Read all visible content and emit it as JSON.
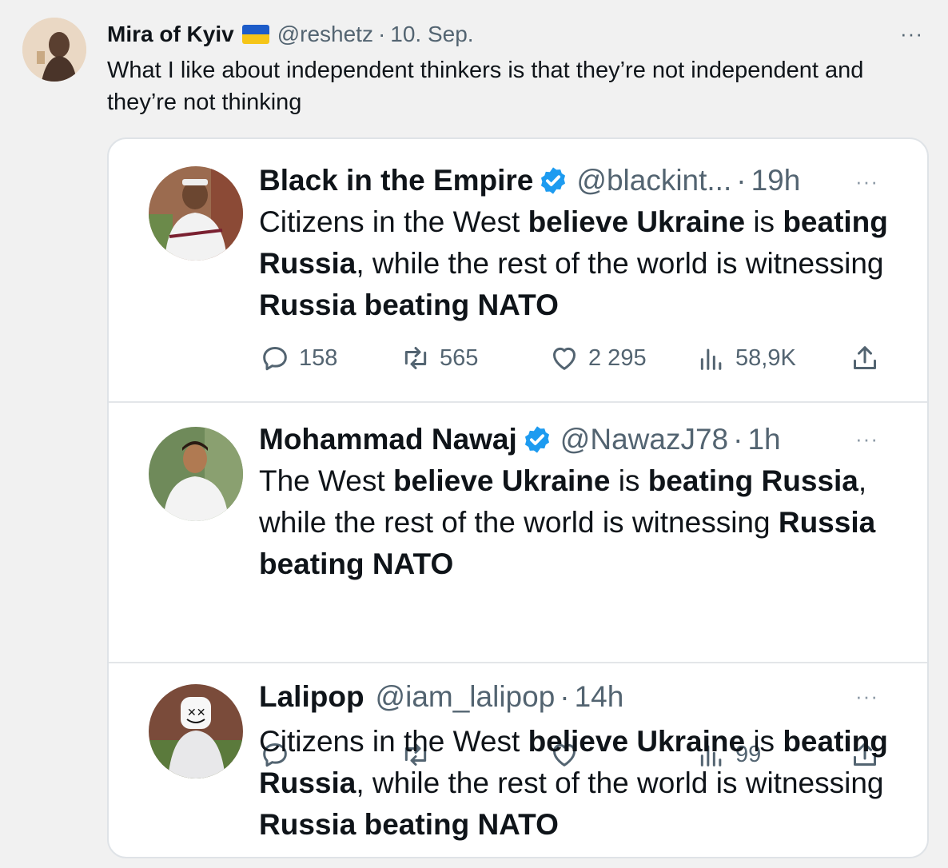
{
  "outer_tweet": {
    "name": "Mira of Kyiv",
    "handle": "@reshetz",
    "separator": "·",
    "date": "10. Sep.",
    "more": "···",
    "text": "What I like about independent thinkers is that they’re not independent and they’re not thinking",
    "flag_colors": [
      "#1d5cc9",
      "#f5c518"
    ]
  },
  "quoted": [
    {
      "name": "Black in the Empire",
      "verified": true,
      "handle": "@blackint...",
      "separator": "·",
      "time": "19h",
      "more": "···",
      "text_parts": [
        {
          "t": "Citizens in the West ",
          "b": false
        },
        {
          "t": "believe Ukraine",
          "b": true
        },
        {
          "t": " is ",
          "b": false
        },
        {
          "t": "beating Russia",
          "b": true
        },
        {
          "t": ", while the rest of the world is witnessing ",
          "b": false
        },
        {
          "t": "Russia beating NATO",
          "b": true
        }
      ],
      "replies": "158",
      "retweets": "565",
      "likes": "2 295",
      "views": "58,9K"
    },
    {
      "name": "Mohammad Nawaj",
      "verified": true,
      "handle": "@NawazJ78",
      "separator": "·",
      "time": "1h",
      "more": "···",
      "text_parts": [
        {
          "t": "The West ",
          "b": false
        },
        {
          "t": "believe Ukraine",
          "b": true
        },
        {
          "t": " is ",
          "b": false
        },
        {
          "t": "beating Russia",
          "b": true
        },
        {
          "t": ", while the rest of the world is witnessing ",
          "b": false
        },
        {
          "t": "Russia beating NATO",
          "b": true
        }
      ],
      "replies": "",
      "retweets": "",
      "likes": "",
      "views": "99"
    },
    {
      "name": "Lalipop",
      "verified": false,
      "handle": "@iam_lalipop",
      "separator": "·",
      "time": "14h",
      "more": "···",
      "text_parts": [
        {
          "t": "Citizens in the West ",
          "b": false
        },
        {
          "t": "believe Ukraine",
          "b": true
        },
        {
          "t": " is ",
          "b": false
        },
        {
          "t": "beating Russia",
          "b": true
        },
        {
          "t": ", while the rest of the world is witnessing ",
          "b": false
        },
        {
          "t": "Russia beating NATO",
          "b": true
        }
      ]
    }
  ],
  "colors": {
    "verified": "#1d9bf0",
    "muted": "#536471",
    "text": "#0f1419"
  }
}
